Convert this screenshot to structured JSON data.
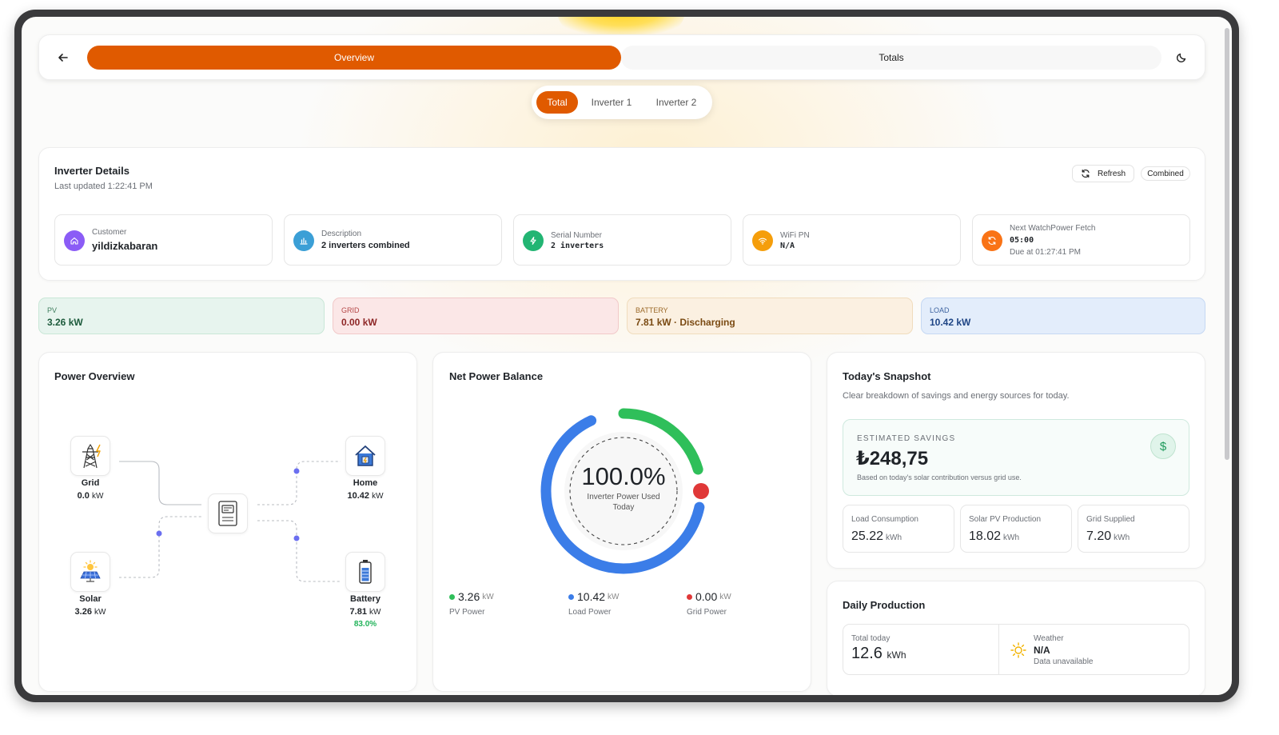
{
  "nav": {
    "overview_tab": "Overview",
    "totals_tab": "Totals"
  },
  "subtabs": [
    "Total",
    "Inverter 1",
    "Inverter 2"
  ],
  "details": {
    "title": "Inverter Details",
    "updated": "Last updated 1:22:41 PM",
    "refresh": "Refresh",
    "combined": "Combined",
    "customer_label": "Customer",
    "customer_value": "yildizkabaran",
    "desc_label": "Description",
    "desc_value": "2 inverters combined",
    "serial_label": "Serial Number",
    "serial_value": "2 inverters",
    "wifi_label": "WiFi PN",
    "wifi_value": "N/A",
    "fetch_label": "Next WatchPower Fetch",
    "fetch_value": "05:00",
    "fetch_due": "Due at 01:27:41 PM"
  },
  "stats": {
    "pv_label": "PV",
    "pv_value": "3.26 kW",
    "grid_label": "GRID",
    "grid_value": "0.00 kW",
    "battery_label": "BATTERY",
    "battery_value": "7.81 kW · Discharging",
    "load_label": "LOAD",
    "load_value": "10.42 kW"
  },
  "power_overview": {
    "title": "Power Overview",
    "grid_name": "Grid",
    "grid_value": "0.0",
    "grid_unit": "kW",
    "solar_name": "Solar",
    "solar_value": "3.26",
    "solar_unit": "kW",
    "home_name": "Home",
    "home_value": "10.42",
    "home_unit": "kW",
    "battery_name": "Battery",
    "battery_value": "7.81",
    "battery_unit": "kW",
    "battery_soc": "83.0%"
  },
  "net_balance": {
    "title": "Net Power Balance",
    "center_value": "100.0%",
    "center_label_1": "Inverter Power Used",
    "center_label_2": "Today",
    "pv_value": "3.26",
    "pv_unit": "kW",
    "pv_label": "PV Power",
    "load_value": "10.42",
    "load_unit": "kW",
    "load_label": "Load Power",
    "grid_value": "0.00",
    "grid_unit": "kW",
    "grid_label": "Grid Power",
    "pv_share": 0.24,
    "colors": {
      "pv": "#2fbf5a",
      "load": "#3b7de8",
      "grid": "#e03838"
    }
  },
  "snapshot": {
    "title": "Today's Snapshot",
    "subtitle": "Clear breakdown of savings and energy sources for today.",
    "savings_label": "ESTIMATED SAVINGS",
    "savings_value": "₺248,75",
    "savings_note": "Based on today's solar contribution versus grid use.",
    "load_label": "Load Consumption",
    "load_value": "25.22",
    "load_unit": "kWh",
    "pv_label": "Solar PV Production",
    "pv_value": "18.02",
    "pv_unit": "kWh",
    "grid_label": "Grid Supplied",
    "grid_value": "7.20",
    "grid_unit": "kWh"
  },
  "daily": {
    "title": "Daily Production",
    "total_label": "Total today",
    "total_value": "12.6",
    "total_unit": "kWh",
    "weather_label": "Weather",
    "weather_value": "N/A",
    "weather_note": "Data unavailable"
  }
}
